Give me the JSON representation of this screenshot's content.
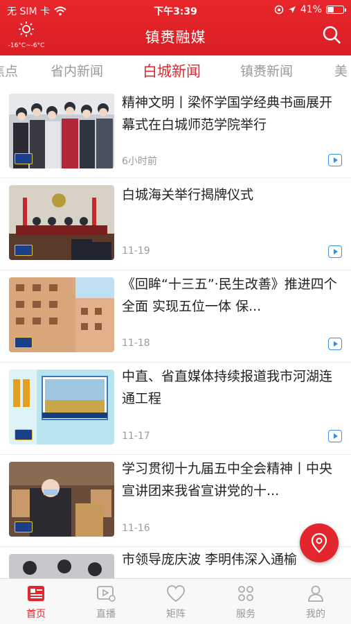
{
  "status_bar": {
    "carrier": "无 SIM 卡",
    "time": "下午3:39",
    "battery": "41%",
    "battery_level": 0.41
  },
  "header": {
    "weather_icon": "sun-icon",
    "temperature": "-16°C~-6°C",
    "title": "镇赉融媒",
    "search_icon": "search-icon"
  },
  "tabs": [
    {
      "label": "焦点",
      "active": false
    },
    {
      "label": "省内新闻",
      "active": false
    },
    {
      "label": "白城新闻",
      "active": true
    },
    {
      "label": "镇赉新闻",
      "active": false
    },
    {
      "label": "美",
      "active": false
    }
  ],
  "news": [
    {
      "title": "精神文明丨梁怀学国学经典书画展开幕式在白城师范学院举行",
      "date": "6小时前",
      "has_video": true
    },
    {
      "title": "白城海关举行揭牌仪式",
      "date": "11-19",
      "has_video": true
    },
    {
      "title": "《回眸“十三五”·民生改善》推进四个全面 实现五位一体 保...",
      "date": "11-18",
      "has_video": true
    },
    {
      "title": "中直、省直媒体持续报道我市河湖连通工程",
      "date": "11-17",
      "has_video": true
    },
    {
      "title": "学习贯彻十九届五中全会精神丨中央宣讲团来我省宣讲党的十...",
      "date": "11-16",
      "has_video": true
    },
    {
      "title": "市领导庞庆波 李明伟深入通榆",
      "date": "",
      "has_video": false
    }
  ],
  "fab_icon": "location-pin-icon",
  "tabbar": [
    {
      "label": "首页",
      "icon": "news-icon",
      "active": true
    },
    {
      "label": "直播",
      "icon": "live-icon",
      "active": false
    },
    {
      "label": "矩阵",
      "icon": "heart-icon",
      "active": false
    },
    {
      "label": "服务",
      "icon": "services-icon",
      "active": false
    },
    {
      "label": "我的",
      "icon": "profile-icon",
      "active": false
    }
  ],
  "colors": {
    "brand_red": "#e3262d",
    "video_blue": "#3a8fe0"
  }
}
